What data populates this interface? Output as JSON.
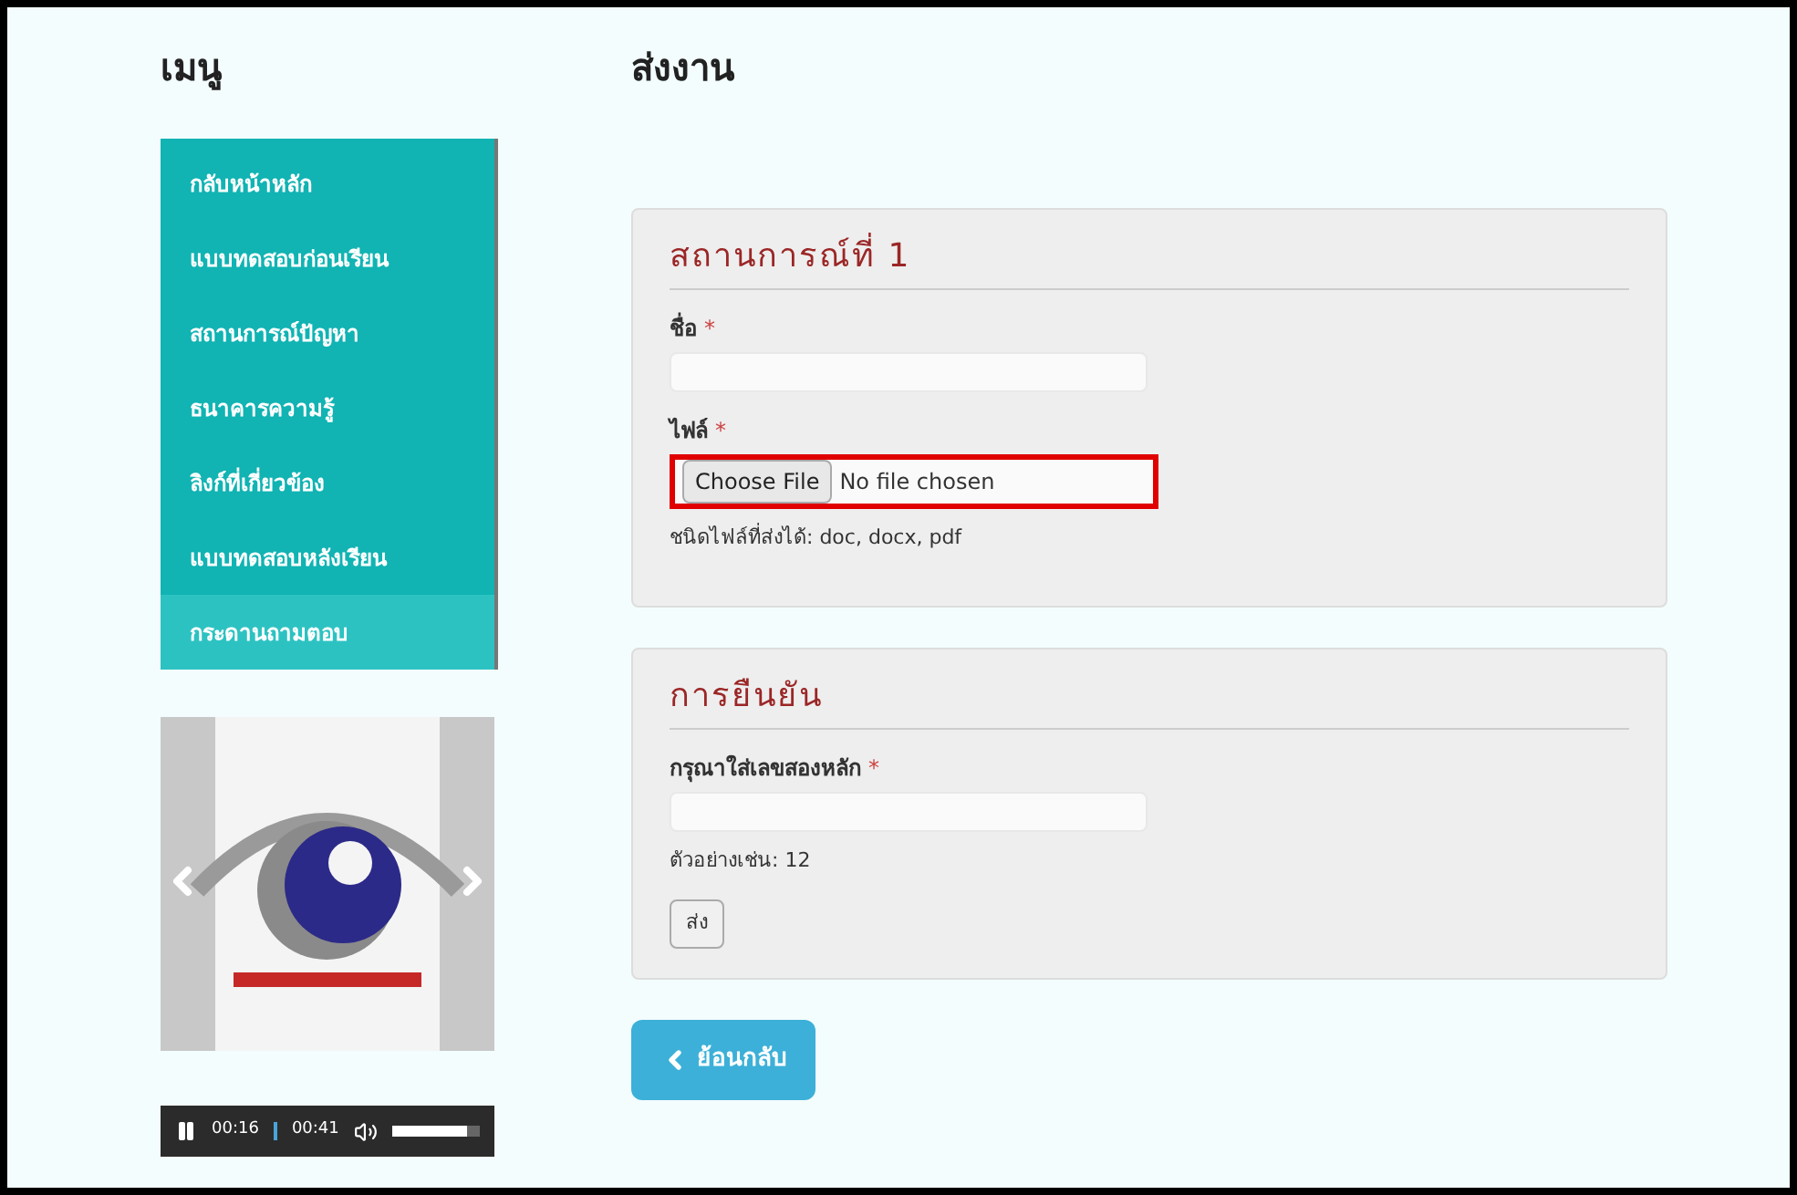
{
  "sidebar": {
    "title": "เมนู",
    "items": [
      {
        "label": "กลับหน้าหลัก",
        "selected": false
      },
      {
        "label": "แบบทดสอบก่อนเรียน",
        "selected": false
      },
      {
        "label": "สถานการณ์ปัญหา",
        "selected": false
      },
      {
        "label": "ธนาคารความรู้",
        "selected": false
      },
      {
        "label": "ลิงก์ที่เกี่ยวข้อง",
        "selected": false
      },
      {
        "label": "แบบทดสอบหลังเรียน",
        "selected": false
      },
      {
        "label": "กระดานถามตอบ",
        "selected": true
      }
    ],
    "player": {
      "elapsed": "00:16",
      "duration": "00:41",
      "volume": {
        "level": 0.85
      }
    }
  },
  "main": {
    "title": "ส่งงาน",
    "sections": [
      {
        "heading": "สถานการณ์ที่ 1",
        "fields": [
          {
            "kind": "text",
            "label": "ชื่อ",
            "required_mark": "*"
          },
          {
            "kind": "file",
            "label": "ไฟล์",
            "required_mark": "*",
            "button": "Choose File",
            "status": "No file chosen",
            "highlighted": true,
            "help": "ชนิดไฟล์ที่ส่งได้: doc, docx, pdf"
          }
        ]
      },
      {
        "heading": "การยืนยัน",
        "fields": [
          {
            "kind": "text",
            "label": "กรุณาใส่เลขสองหลัก",
            "required_mark": "*",
            "help": "ตัวอย่างเช่น: 12"
          }
        ],
        "submit": "ส่ง"
      }
    ],
    "back_button": "ย้อนกลับ"
  }
}
